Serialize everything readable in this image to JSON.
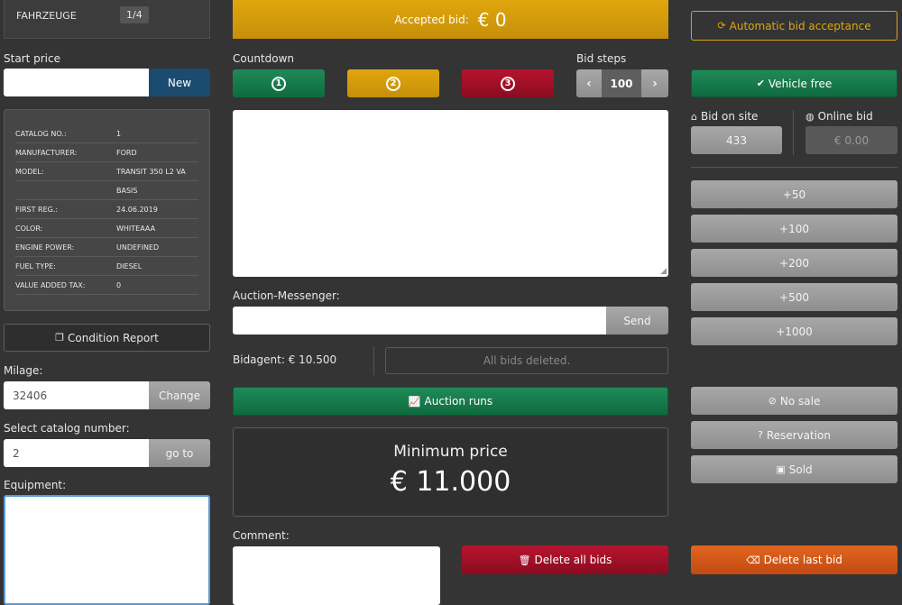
{
  "top": {
    "vehicles_label": "FAHRZEUGE",
    "vehicles_count": "1/4",
    "accepted_bid_label": "Accepted bid:",
    "accepted_bid_value": "€ 0",
    "auto_accept_label": "Automatic bid acceptance"
  },
  "left": {
    "start_price_label": "Start price",
    "new_label": "New",
    "info": [
      {
        "k": "CATALOG NO.:",
        "v": "1"
      },
      {
        "k": "MANUFACTURER:",
        "v": "FORD"
      },
      {
        "k": "MODEL:",
        "v": "TRANSIT 350 L2 VA"
      },
      {
        "k": "",
        "v": "BASIS"
      },
      {
        "k": "FIRST REG.:",
        "v": "24.06.2019"
      },
      {
        "k": "COLOR:",
        "v": "WHITEAAA"
      },
      {
        "k": "ENGINE POWER:",
        "v": "UNDEFINED"
      },
      {
        "k": "FUEL TYPE:",
        "v": "DIESEL"
      },
      {
        "k": "VALUE ADDED TAX:",
        "v": "0"
      }
    ],
    "condition_report_label": "Condition Report",
    "milage_label": "Milage:",
    "milage_value": "32406",
    "change_label": "Change",
    "catalog_label": "Select catalog number:",
    "catalog_value": "2",
    "goto_label": "go to",
    "equipment_label": "Equipment:"
  },
  "middle": {
    "countdown_label": "Countdown",
    "c1": "1",
    "c2": "2",
    "c3": "3",
    "bid_steps_label": "Bid steps",
    "bid_steps_value": "100",
    "messenger_label": "Auction-Messenger:",
    "send_label": "Send",
    "bidagent_label": "Bidagent: € 10.500",
    "all_bids_deleted": "All bids deleted.",
    "auction_runs_label": "Auction runs",
    "min_price_label": "Minimum price",
    "min_price_value": "€ 11.000",
    "comment_label": "Comment:",
    "delete_all_label": "Delete all bids"
  },
  "right": {
    "vehicle_free_label": "Vehicle free",
    "bid_on_site_label": "Bid on site",
    "bid_on_site_value": "433",
    "online_bid_label": "Online bid",
    "online_bid_value": "€ 0.00",
    "increments": [
      "+50",
      "+100",
      "+200",
      "+500",
      "+1000"
    ],
    "no_sale_label": "No sale",
    "reservation_label": "Reservation",
    "sold_label": "Sold",
    "delete_last_label": "Delete last bid"
  },
  "colors": {
    "green": "#168050",
    "yellow": "#d8a20e",
    "red": "#a8102a",
    "orange": "#d9581a",
    "navy": "#1b4b6e"
  }
}
